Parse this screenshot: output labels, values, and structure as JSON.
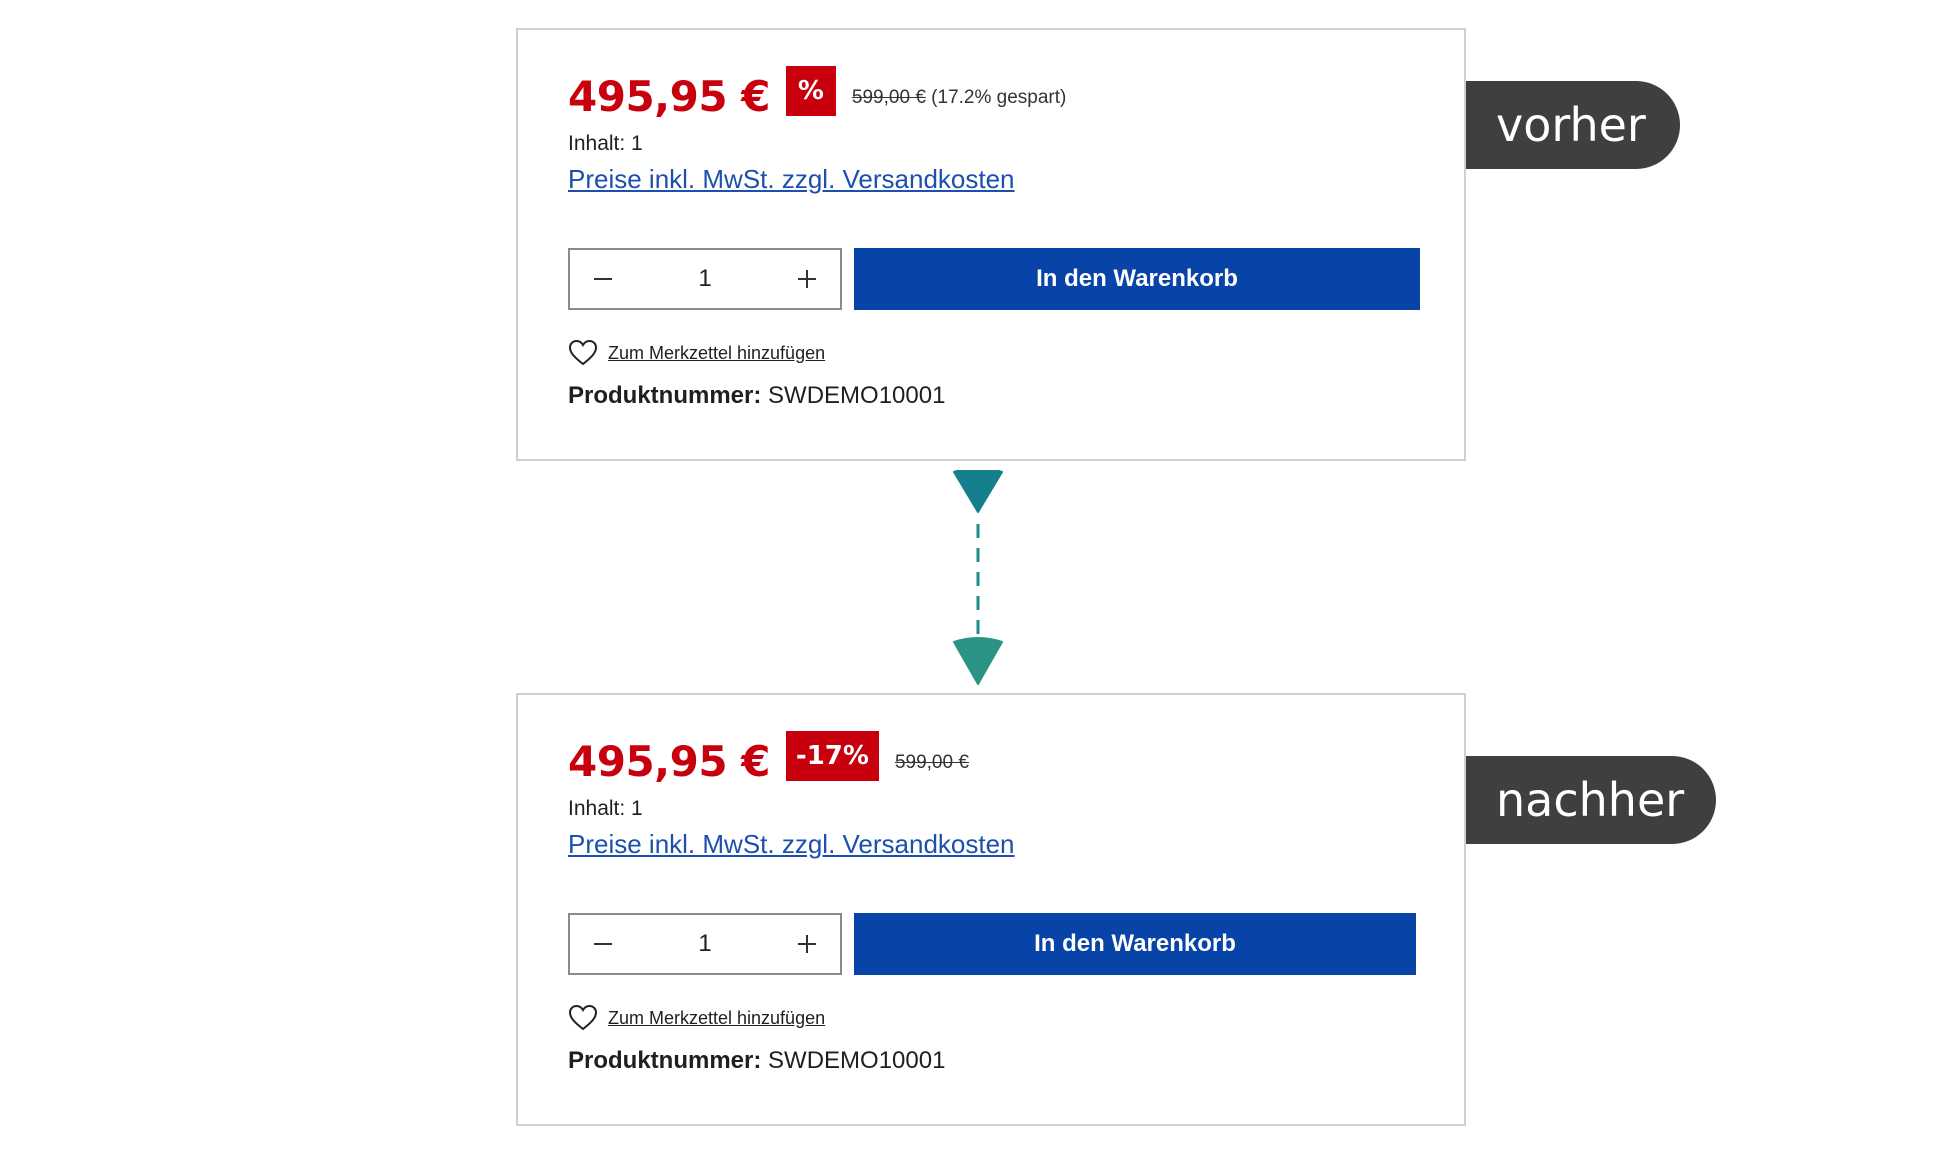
{
  "colors": {
    "price_red": "#c8000e",
    "link_blue": "#1c4fae",
    "button_blue": "#0843a8",
    "tag_gray": "#3f3f3f",
    "arrow_top": "#167f8e",
    "arrow_bottom": "#2b9383"
  },
  "before": {
    "tag_label": "vorher",
    "price": "495,95 €",
    "badge": "%",
    "list_price": "599,00 €",
    "savings": "(17.2% gespart)",
    "content_label": "Inhalt: 1",
    "tax_link": "Preise inkl. MwSt. zzgl. Versandkosten",
    "quantity": "1",
    "cart_button": "In den Warenkorb",
    "wishlist_label": "Zum Merkzettel hinzufügen",
    "product_number_label": "Produktnummer:",
    "product_number_value": "SWDEMO10001"
  },
  "after": {
    "tag_label": "nachher",
    "price": "495,95 €",
    "badge": "-17%",
    "list_price": "599,00 €",
    "content_label": "Inhalt: 1",
    "tax_link": "Preise inkl. MwSt. zzgl. Versandkosten",
    "quantity": "1",
    "cart_button": "In den Warenkorb",
    "wishlist_label": "Zum Merkzettel hinzufügen",
    "product_number_label": "Produktnummer:",
    "product_number_value": "SWDEMO10001"
  },
  "icons": {
    "minus": "minus-icon",
    "plus": "plus-icon",
    "wishlist": "heart-icon",
    "connector": "dashed-arrow-connector"
  }
}
